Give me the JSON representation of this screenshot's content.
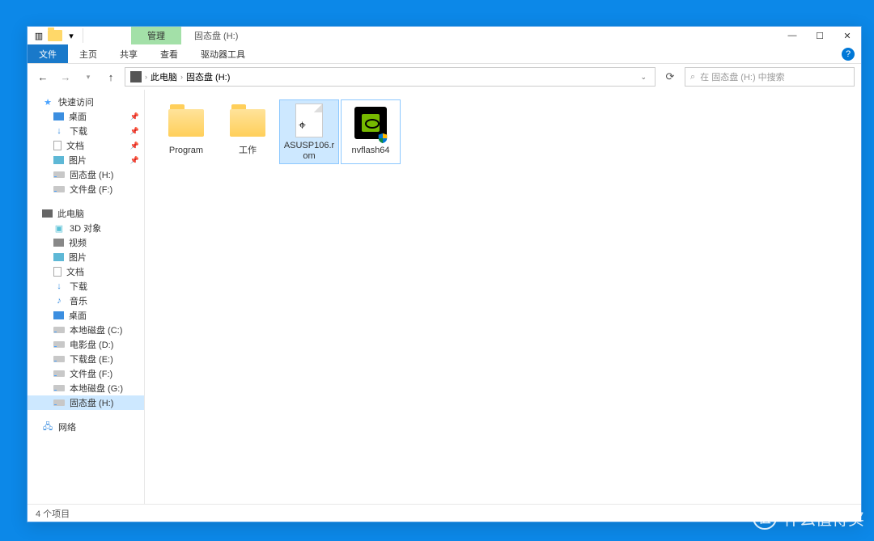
{
  "title_context_tab": "管理",
  "title_location": "固态盘 (H:)",
  "ribbon": {
    "file": "文件",
    "home": "主页",
    "share": "共享",
    "view": "查看",
    "drive": "驱动器工具"
  },
  "breadcrumb": {
    "pc": "此电脑",
    "loc": "固态盘 (H:)"
  },
  "search_placeholder": "在 固态盘 (H:) 中搜索",
  "nav": {
    "quick": "快速访问",
    "desktop": "桌面",
    "downloads": "下载",
    "documents": "文档",
    "pictures": "图片",
    "ssd_h": "固态盘 (H:)",
    "docs_f": "文件盘 (F:)",
    "thispc": "此电脑",
    "obj3d": "3D 对象",
    "videos": "视频",
    "pictures2": "图片",
    "documents2": "文档",
    "downloads2": "下载",
    "music": "音乐",
    "desktop2": "桌面",
    "local_c": "本地磁盘 (C:)",
    "movie_d": "电影盘 (D:)",
    "dl_e": "下载盘 (E:)",
    "docs_f2": "文件盘 (F:)",
    "local_g": "本地磁盘 (G:)",
    "ssd_h2": "固态盘 (H:)",
    "network": "网络"
  },
  "files": {
    "program": "Program",
    "work": "工作",
    "rom": "ASUSP106.rom",
    "nvflash": "nvflash64"
  },
  "status": "4 个项目",
  "watermark": "什么值得买"
}
